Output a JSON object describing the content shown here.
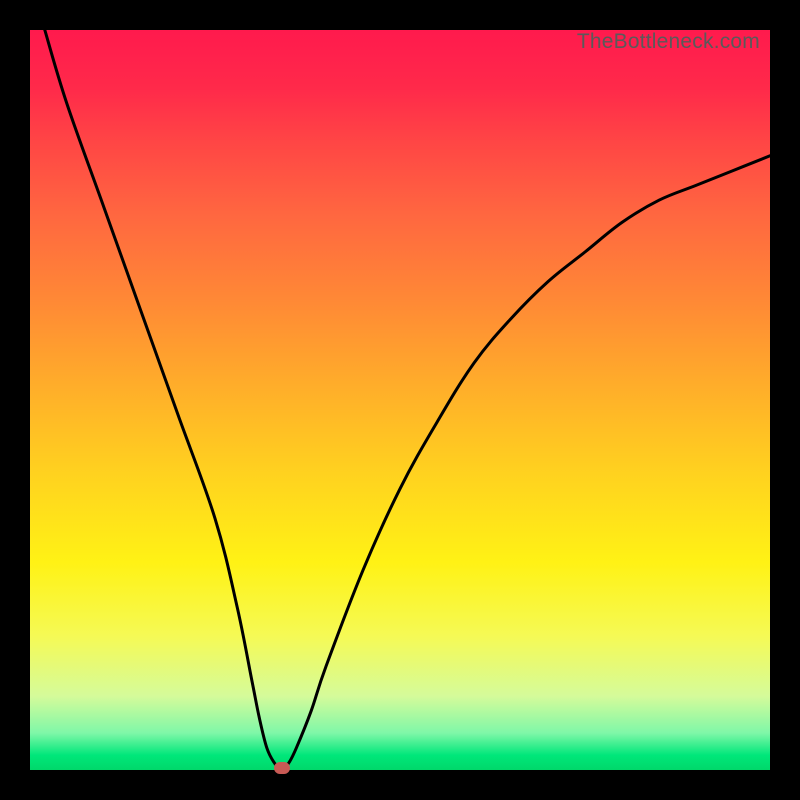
{
  "watermark": "TheBottleneck.com",
  "chart_data": {
    "type": "line",
    "title": "",
    "xlabel": "",
    "ylabel": "",
    "xlim": [
      0,
      100
    ],
    "ylim": [
      0,
      100
    ],
    "grid": false,
    "series": [
      {
        "name": "bottleneck-curve",
        "x": [
          2,
          5,
          10,
          15,
          20,
          25,
          28,
          30,
          31,
          32,
          33,
          34,
          35,
          36,
          38,
          40,
          45,
          50,
          55,
          60,
          65,
          70,
          75,
          80,
          85,
          90,
          95,
          100
        ],
        "values": [
          100,
          90,
          76,
          62,
          48,
          34,
          22,
          12,
          7,
          3,
          1,
          0,
          1,
          3,
          8,
          14,
          27,
          38,
          47,
          55,
          61,
          66,
          70,
          74,
          77,
          79,
          81,
          83
        ]
      }
    ],
    "marker": {
      "x": 34,
      "y": 0
    },
    "gradient_stops": [
      {
        "pos": 0.0,
        "color": "#ff1a4d"
      },
      {
        "pos": 0.25,
        "color": "#ff6740"
      },
      {
        "pos": 0.5,
        "color": "#ffb428"
      },
      {
        "pos": 0.75,
        "color": "#fff215"
      },
      {
        "pos": 0.95,
        "color": "#7ff7a8"
      },
      {
        "pos": 1.0,
        "color": "#00d86a"
      }
    ]
  }
}
